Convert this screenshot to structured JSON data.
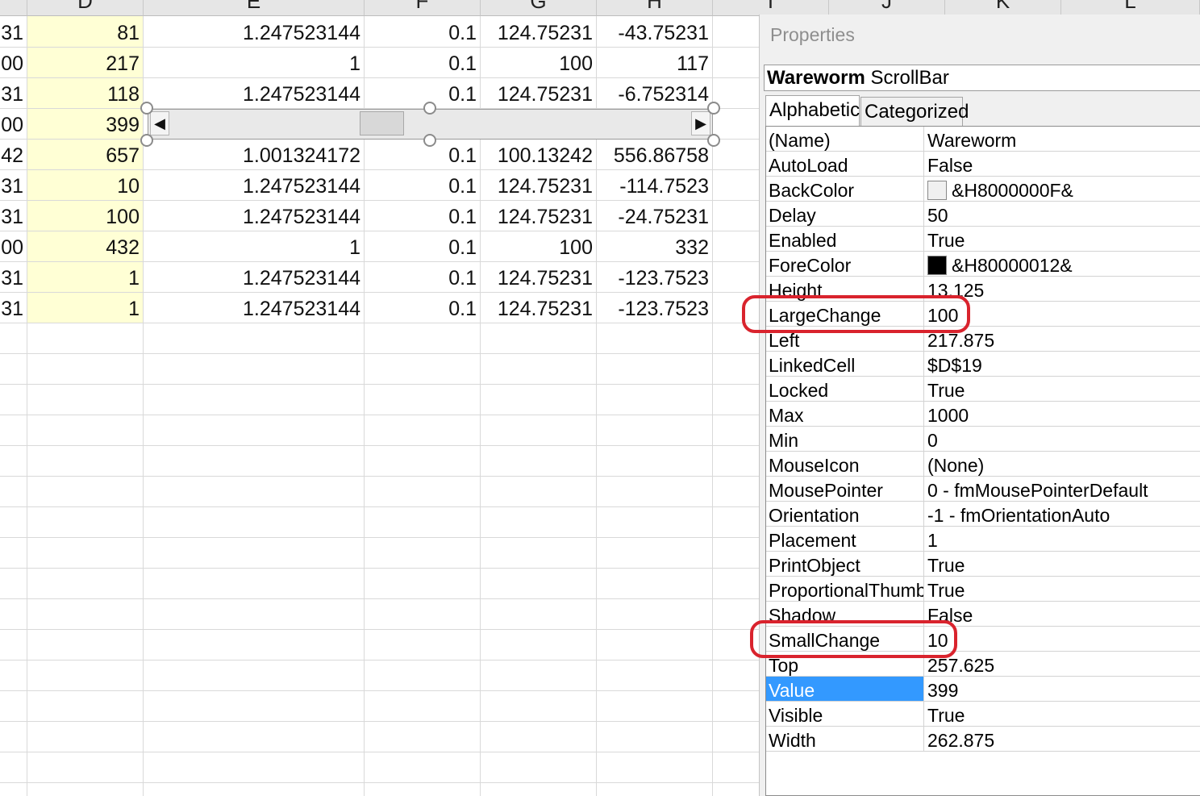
{
  "sheet": {
    "columns": [
      "D",
      "E",
      "F",
      "G",
      "H",
      "I",
      "J",
      "K",
      "L"
    ],
    "rows": [
      {
        "c": "31",
        "d": "81",
        "e": "1.247523144",
        "f": "0.1",
        "g": "124.75231",
        "h": "-43.75231"
      },
      {
        "c": "00",
        "d": "217",
        "e": "1",
        "f": "0.1",
        "g": "100",
        "h": "117"
      },
      {
        "c": "31",
        "d": "118",
        "e": "1.247523144",
        "f": "0.1",
        "g": "124.75231",
        "h": "-6.752314"
      },
      {
        "c": "00",
        "d": "399",
        "e": "",
        "f": "",
        "g": "",
        "h": ""
      },
      {
        "c": "42",
        "d": "657",
        "e": "1.001324172",
        "f": "0.1",
        "g": "100.13242",
        "h": "556.86758"
      },
      {
        "c": "31",
        "d": "10",
        "e": "1.247523144",
        "f": "0.1",
        "g": "124.75231",
        "h": "-114.7523"
      },
      {
        "c": "31",
        "d": "100",
        "e": "1.247523144",
        "f": "0.1",
        "g": "124.75231",
        "h": "-24.75231"
      },
      {
        "c": "00",
        "d": "432",
        "e": "1",
        "f": "0.1",
        "g": "100",
        "h": "332"
      },
      {
        "c": "31",
        "d": "1",
        "e": "1.247523144",
        "f": "0.1",
        "g": "124.75231",
        "h": "-123.7523"
      },
      {
        "c": "31",
        "d": "1",
        "e": "1.247523144",
        "f": "0.1",
        "g": "124.75231",
        "h": "-123.7523"
      }
    ],
    "scrollbar": {
      "left_arrow": "◀",
      "right_arrow": "▶",
      "value_fraction": 0.399
    }
  },
  "properties": {
    "title": "Properties",
    "object_name": "Wareworm",
    "object_type": "ScrollBar",
    "tabs": [
      "Alphabetic",
      "Categorized"
    ],
    "rows": [
      {
        "name": "(Name)",
        "value": "Wareworm"
      },
      {
        "name": "AutoLoad",
        "value": "False"
      },
      {
        "name": "BackColor",
        "value": "&H8000000F&",
        "swatch": "#f0f0f0"
      },
      {
        "name": "Delay",
        "value": "50"
      },
      {
        "name": "Enabled",
        "value": "True"
      },
      {
        "name": "ForeColor",
        "value": "&H80000012&",
        "swatch": "#000000"
      },
      {
        "name": "Height",
        "value": "13.125"
      },
      {
        "name": "LargeChange",
        "value": "100"
      },
      {
        "name": "Left",
        "value": "217.875"
      },
      {
        "name": "LinkedCell",
        "value": "$D$19"
      },
      {
        "name": "Locked",
        "value": "True"
      },
      {
        "name": "Max",
        "value": "1000"
      },
      {
        "name": "Min",
        "value": "0"
      },
      {
        "name": "MouseIcon",
        "value": "(None)"
      },
      {
        "name": "MousePointer",
        "value": "0 - fmMousePointerDefault"
      },
      {
        "name": "Orientation",
        "value": "-1 - fmOrientationAuto"
      },
      {
        "name": "Placement",
        "value": "1"
      },
      {
        "name": "PrintObject",
        "value": "True"
      },
      {
        "name": "ProportionalThumb",
        "value": "True"
      },
      {
        "name": "Shadow",
        "value": "False"
      },
      {
        "name": "SmallChange",
        "value": "10"
      },
      {
        "name": "Top",
        "value": "257.625"
      },
      {
        "name": "Value",
        "value": "399"
      },
      {
        "name": "Visible",
        "value": "True"
      },
      {
        "name": "Width",
        "value": "262.875"
      }
    ],
    "selected": "Value",
    "highlighted": [
      "LargeChange",
      "SmallChange"
    ],
    "colors": {
      "selection": "#3399ff",
      "highlight_marker": "#d9232d"
    }
  }
}
